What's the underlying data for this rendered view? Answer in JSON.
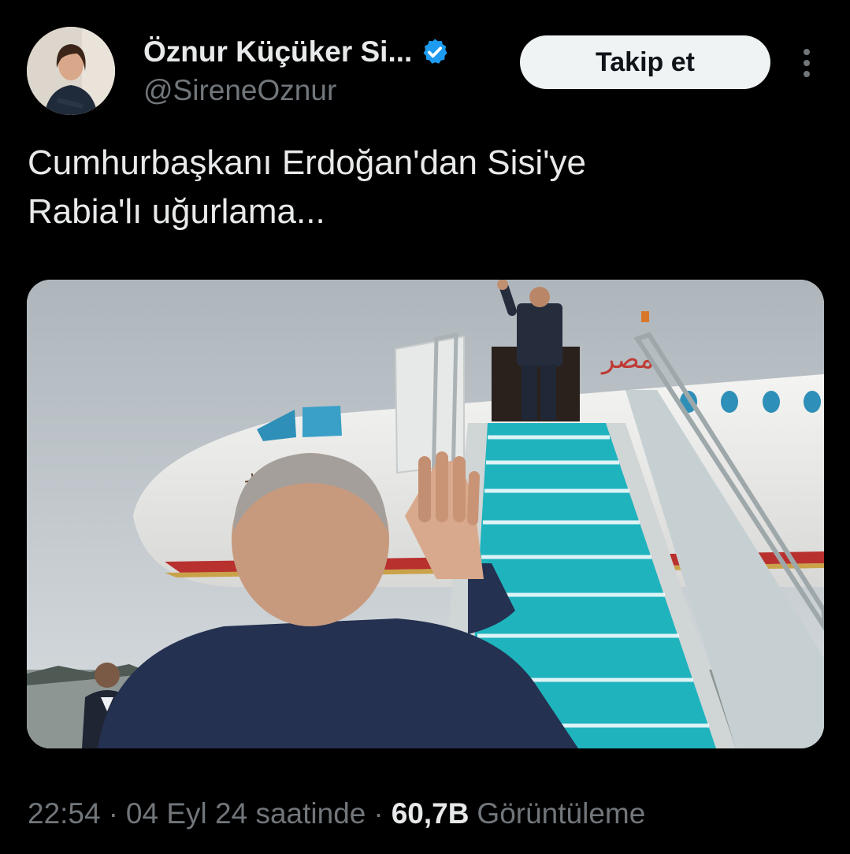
{
  "header": {
    "display_name": "Öznur Küçüker Si...",
    "handle": "@SireneOznur",
    "follow_label": "Takip et",
    "verified_badge_icon": "verified-badge-icon",
    "more_icon": "more-options-icon"
  },
  "tweet": {
    "text": "Cumhurbaşkanı Erdoğan'dan Sisi'ye\nRabia'lı uğurlama...",
    "media": {
      "aircraft_livery_text": "تحيا مصر",
      "aircraft_title_text": "مصر"
    }
  },
  "meta": {
    "time": "22:54",
    "separator": "·",
    "date": "04 Eyl 24 saatinde",
    "views_count": "60,7B",
    "views_label": "Görüntüleme"
  },
  "colors": {
    "background": "#000000",
    "primary_text": "#e7e9ea",
    "secondary_text": "#71767b",
    "verified_blue": "#1d9bf0",
    "button_bg": "#eff3f4",
    "stairs_turquoise": "#1fb3bd"
  }
}
